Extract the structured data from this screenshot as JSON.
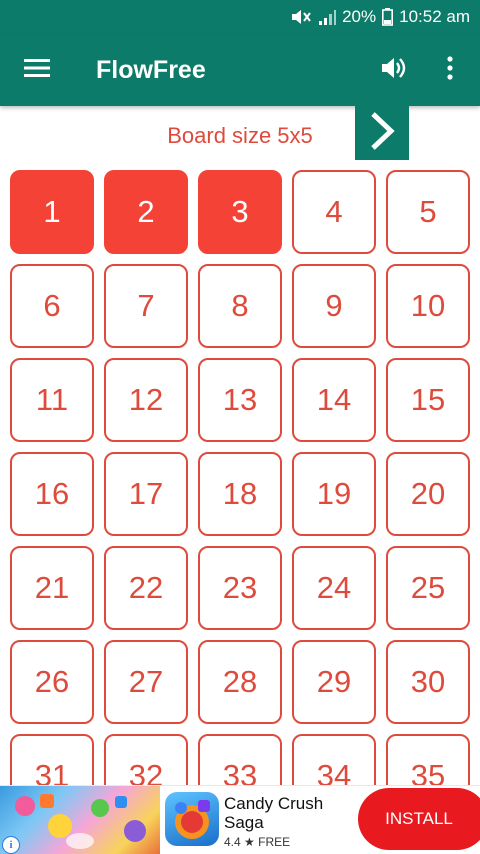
{
  "status": {
    "battery": "20%",
    "time": "10:52 am"
  },
  "app": {
    "title": "FlowFree"
  },
  "board": {
    "size_label": "Board size 5x5"
  },
  "levels": [
    {
      "label": "1",
      "completed": true
    },
    {
      "label": "2",
      "completed": true
    },
    {
      "label": "3",
      "completed": true
    },
    {
      "label": "4",
      "completed": false
    },
    {
      "label": "5",
      "completed": false
    },
    {
      "label": "6",
      "completed": false
    },
    {
      "label": "7",
      "completed": false
    },
    {
      "label": "8",
      "completed": false
    },
    {
      "label": "9",
      "completed": false
    },
    {
      "label": "10",
      "completed": false
    },
    {
      "label": "11",
      "completed": false
    },
    {
      "label": "12",
      "completed": false
    },
    {
      "label": "13",
      "completed": false
    },
    {
      "label": "14",
      "completed": false
    },
    {
      "label": "15",
      "completed": false
    },
    {
      "label": "16",
      "completed": false
    },
    {
      "label": "17",
      "completed": false
    },
    {
      "label": "18",
      "completed": false
    },
    {
      "label": "19",
      "completed": false
    },
    {
      "label": "20",
      "completed": false
    },
    {
      "label": "21",
      "completed": false
    },
    {
      "label": "22",
      "completed": false
    },
    {
      "label": "23",
      "completed": false
    },
    {
      "label": "24",
      "completed": false
    },
    {
      "label": "25",
      "completed": false
    },
    {
      "label": "26",
      "completed": false
    },
    {
      "label": "27",
      "completed": false
    },
    {
      "label": "28",
      "completed": false
    },
    {
      "label": "29",
      "completed": false
    },
    {
      "label": "30",
      "completed": false
    },
    {
      "label": "31",
      "completed": false
    },
    {
      "label": "32",
      "completed": false
    },
    {
      "label": "33",
      "completed": false
    },
    {
      "label": "34",
      "completed": false
    },
    {
      "label": "35",
      "completed": false
    }
  ],
  "ad": {
    "app_name": "Candy Crush Saga",
    "rating": "4.4 ★ FREE",
    "install_label": "INSTALL"
  },
  "colors": {
    "primary": "#0d7b69",
    "accent": "#de4b3c",
    "completed_fill": "#f44336",
    "install": "#e8191f"
  }
}
